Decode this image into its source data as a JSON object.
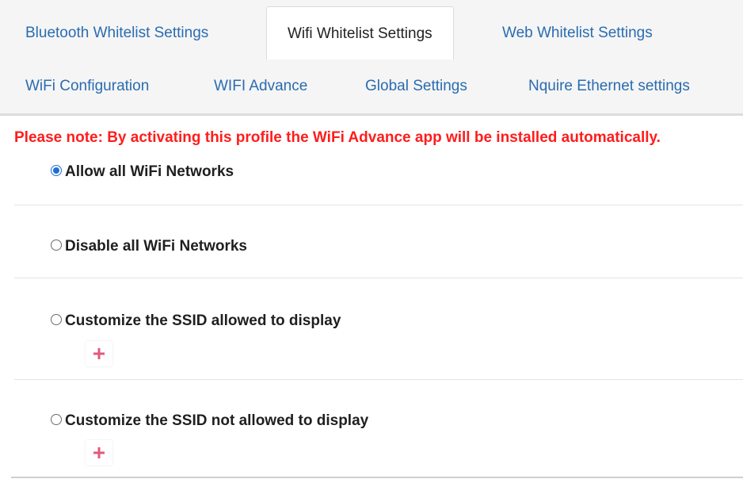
{
  "tabs": {
    "bluetooth": "Bluetooth Whitelist Settings",
    "wifi_whitelist": "Wifi Whitelist Settings",
    "web_whitelist": "Web Whitelist Settings",
    "wifi_configuration": "WiFi Configuration",
    "wifi_advance": "WIFI Advance",
    "global_settings": "Global Settings",
    "nquire_ethernet": "Nquire Ethernet settings",
    "active_tab": "Wifi Whitelist Settings"
  },
  "note": "Please note: By activating this profile the WiFi Advance app will be installed automatically.",
  "options": {
    "allow_all": {
      "label": "Allow all WiFi Networks",
      "checked": true
    },
    "disable_all": {
      "label": "Disable all WiFi Networks",
      "checked": false
    },
    "customize_allowed": {
      "label": "Customize the SSID allowed to display",
      "checked": false
    },
    "customize_not_allowed": {
      "label": "Customize the SSID not allowed to display",
      "checked": false
    }
  },
  "icons": {
    "add": "plus-icon"
  },
  "colors": {
    "link": "#2a6cb0",
    "warning": "#ff1c1c",
    "radio_checked": "#1f6fd1",
    "plus": "#e05a7e"
  }
}
